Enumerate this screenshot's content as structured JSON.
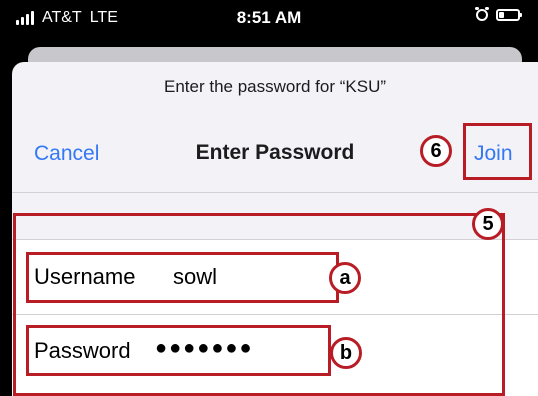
{
  "status_bar": {
    "carrier": "AT&T",
    "network": "LTE",
    "time": "8:51 AM"
  },
  "dialog": {
    "prompt": "Enter the password for “KSU”",
    "title": "Enter Password",
    "cancel_label": "Cancel",
    "join_label": "Join",
    "username": {
      "label": "Username",
      "value": "sowl"
    },
    "password": {
      "label": "Password",
      "masked_value": "●●●●●●●"
    }
  },
  "annotations": {
    "join": "6",
    "fields_group": "5",
    "username": "a",
    "password": "b"
  },
  "colors": {
    "ios_blue": "#3478f6",
    "annotation_red": "#b81d25",
    "sheet_background": "#f2f2f7"
  },
  "icons": [
    "cellular-signal-icon",
    "alarm-icon",
    "battery-icon"
  ]
}
